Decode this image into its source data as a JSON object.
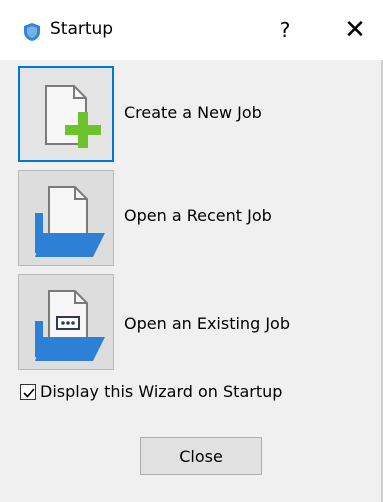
{
  "window": {
    "title": "Startup",
    "help_glyph": "?",
    "close_glyph": "✕",
    "icon": "shield-app-icon"
  },
  "actions": [
    {
      "label": "Create a New Job",
      "icon": "new-document-plus-icon",
      "selected": true
    },
    {
      "label": "Open a Recent Job",
      "icon": "open-folder-icon",
      "selected": false
    },
    {
      "label": "Open an Existing Job",
      "icon": "open-folder-dots-icon",
      "selected": false
    }
  ],
  "options": {
    "display_wizard_label": "Display this Wizard on Startup",
    "display_wizard_checked": true
  },
  "footer": {
    "close_label": "Close"
  },
  "colors": {
    "accent": "#0078d7",
    "plus_green": "#6cc32b",
    "folder_blue": "#2e80d6",
    "app_icon": "#2f86d8"
  }
}
